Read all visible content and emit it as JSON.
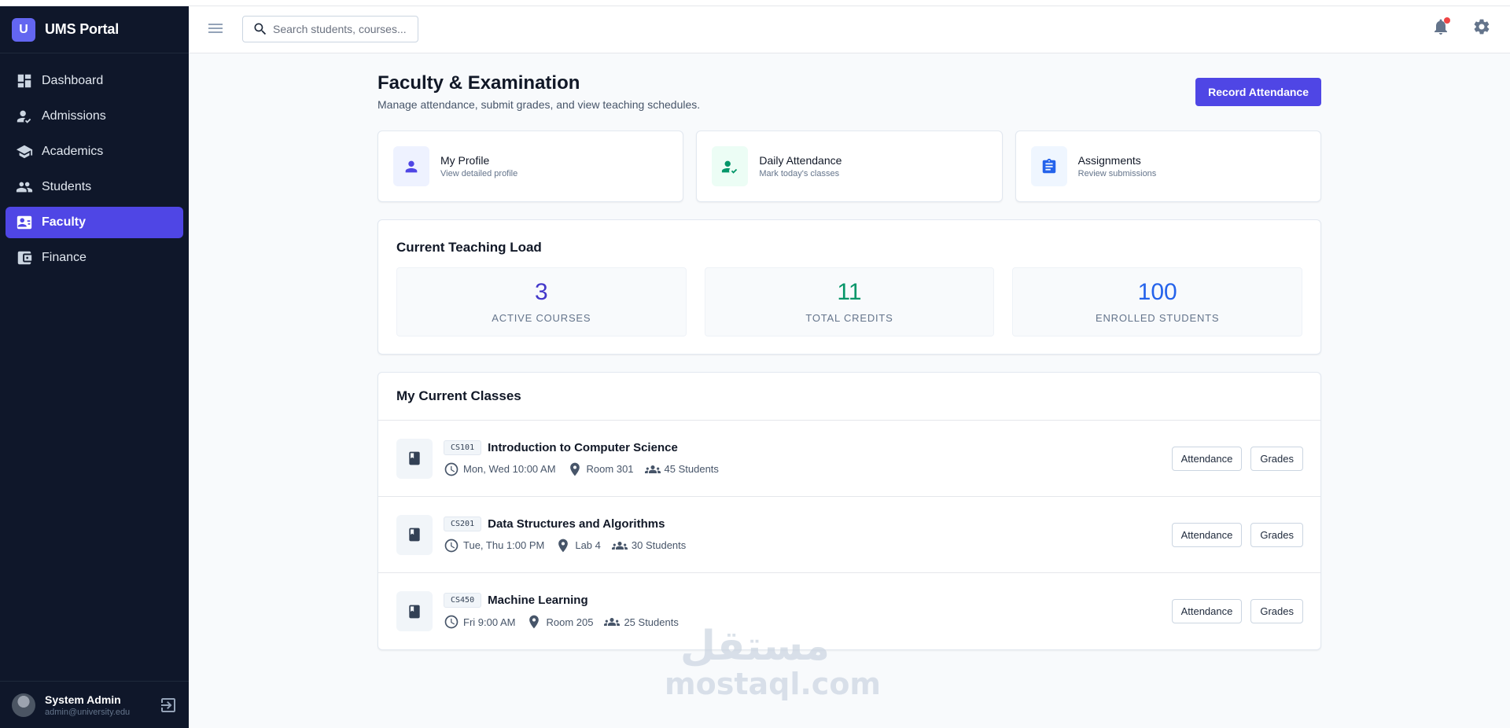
{
  "app": {
    "badge": "U",
    "name": "UMS Portal"
  },
  "sidebar": {
    "items": [
      {
        "label": "Dashboard",
        "icon": "dashboard-icon",
        "active": false
      },
      {
        "label": "Admissions",
        "icon": "admissions-icon",
        "active": false
      },
      {
        "label": "Academics",
        "icon": "academics-icon",
        "active": false
      },
      {
        "label": "Students",
        "icon": "students-icon",
        "active": false
      },
      {
        "label": "Faculty",
        "icon": "faculty-icon",
        "active": true
      },
      {
        "label": "Finance",
        "icon": "finance-icon",
        "active": false
      }
    ],
    "user": {
      "name": "System Admin",
      "email": "admin@university.edu"
    }
  },
  "header": {
    "search_placeholder": "Search students, courses..."
  },
  "page": {
    "title": "Faculty & Examination",
    "subtitle": "Manage attendance, submit grades, and view teaching schedules.",
    "primary_action": "Record Attendance"
  },
  "quick_actions": [
    {
      "title": "My Profile",
      "subtitle": "View detailed profile",
      "icon": "person-icon",
      "bg": "#eef2ff",
      "color": "#4f46e5"
    },
    {
      "title": "Daily Attendance",
      "subtitle": "Mark today's classes",
      "icon": "attendance-check-icon",
      "bg": "#ecfdf5",
      "color": "#059669"
    },
    {
      "title": "Assignments",
      "subtitle": "Review submissions",
      "icon": "clipboard-icon",
      "bg": "#eff6ff",
      "color": "#2563eb"
    }
  ],
  "teaching_load": {
    "title": "Current Teaching Load",
    "stats": [
      {
        "value": "3",
        "label": "ACTIVE COURSES",
        "color": "#4338ca"
      },
      {
        "value": "11",
        "label": "TOTAL CREDITS",
        "color": "#059669"
      },
      {
        "value": "100",
        "label": "ENROLLED STUDENTS",
        "color": "#2563eb"
      }
    ]
  },
  "classes": {
    "title": "My Current Classes",
    "attendance_label": "Attendance",
    "grades_label": "Grades",
    "rows": [
      {
        "code": "CS101",
        "name": "Introduction to Computer Science",
        "schedule": "Mon, Wed 10:00 AM",
        "room": "Room 301",
        "students": "45 Students"
      },
      {
        "code": "CS201",
        "name": "Data Structures and Algorithms",
        "schedule": "Tue, Thu 1:00 PM",
        "room": "Lab 4",
        "students": "30 Students"
      },
      {
        "code": "CS450",
        "name": "Machine Learning",
        "schedule": "Fri 9:00 AM",
        "room": "Room 205",
        "students": "25 Students"
      }
    ]
  },
  "watermark": {
    "arabic": "مستقل",
    "latin": "mostaql.com"
  }
}
